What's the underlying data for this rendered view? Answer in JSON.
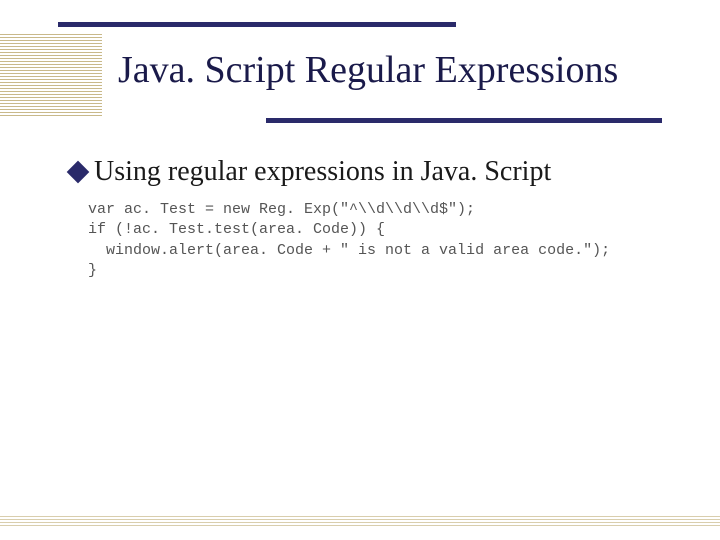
{
  "title": "Java. Script Regular Expressions",
  "bullet": "Using regular expressions in Java. Script",
  "code": {
    "line1": "var ac. Test = new Reg. Exp(\"^\\\\d\\\\d\\\\d$\");",
    "line2": "if (!ac. Test.test(area. Code)) {",
    "line3": "  window.alert(area. Code + \" is not a valid area code.\");",
    "line4": "}"
  }
}
